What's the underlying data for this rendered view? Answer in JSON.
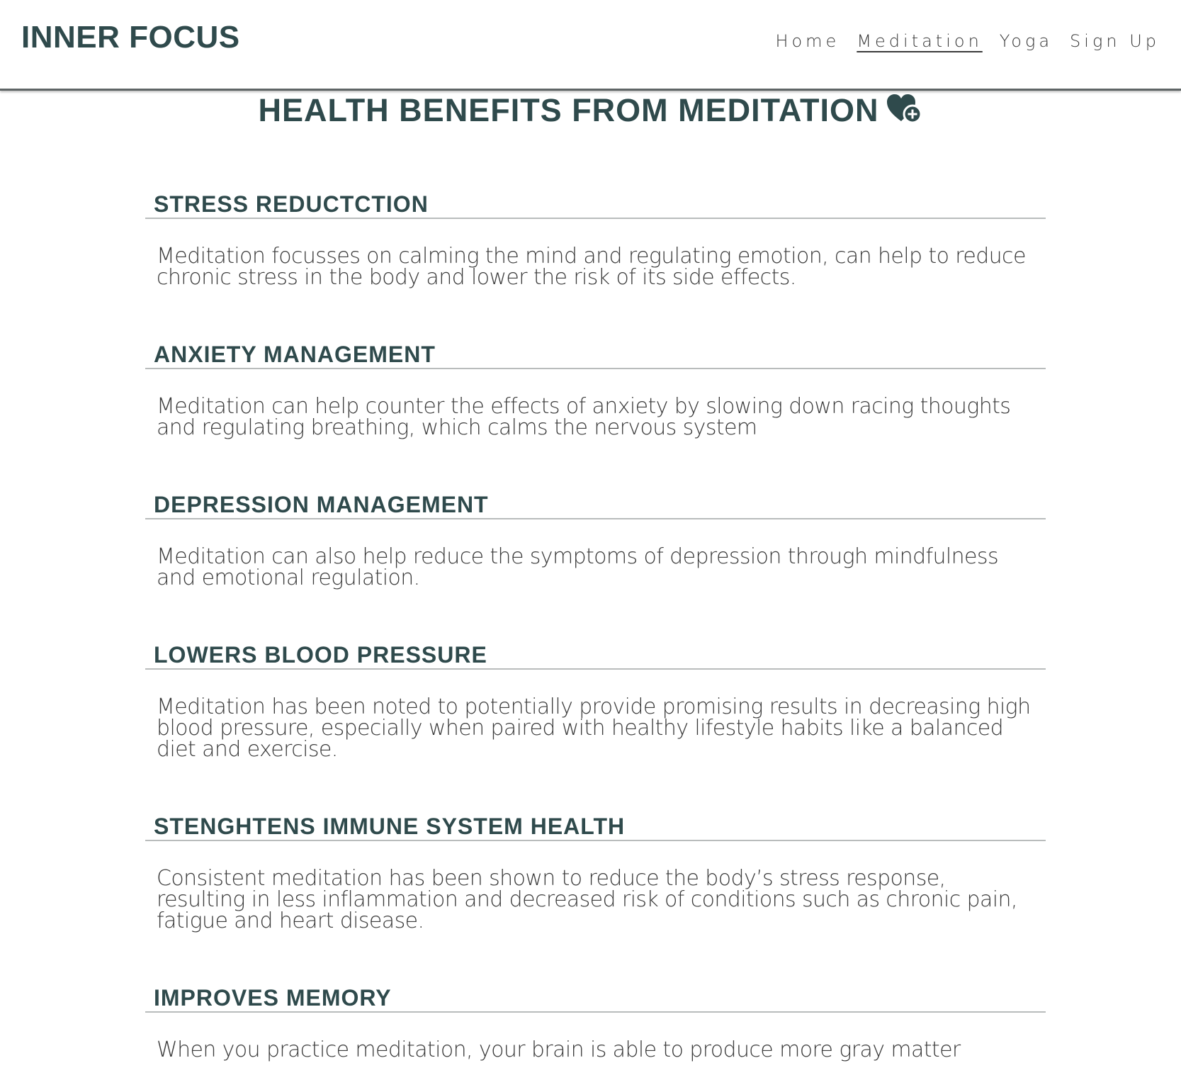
{
  "site": {
    "logo": "INNER FOCUS"
  },
  "nav": {
    "items": [
      {
        "label": "Home",
        "active": false
      },
      {
        "label": "Meditation",
        "active": true
      },
      {
        "label": "Yoga",
        "active": false
      },
      {
        "label": "Sign Up",
        "active": false
      }
    ]
  },
  "page": {
    "title": "HEALTH BENEFITS FROM MEDITATION",
    "title_icon": "heart-plus-icon"
  },
  "sections": [
    {
      "heading": "STRESS REDUCTCTION",
      "body": "Meditation focusses on calming the mind and regulating emotion, can help to reduce chronic stress in the body and lower the risk of its side effects."
    },
    {
      "heading": "ANXIETY MANAGEMENT",
      "body": "Meditation can help counter the effects of anxiety by slowing down racing thoughts and regulating breathing, which calms the nervous system"
    },
    {
      "heading": "DEPRESSION MANAGEMENT",
      "body": "Meditation can also help reduce the symptoms of depression through mindfulness and emotional regulation."
    },
    {
      "heading": "LOWERS BLOOD PRESSURE",
      "body": "Meditation has been noted to potentially provide promising results in decreasing high blood pressure, especially when paired with healthy lifestyle habits like a balanced diet and exercise."
    },
    {
      "heading": "STENGHTENS IMMUNE SYSTEM HEALTH",
      "body": "Consistent meditation has been shown to reduce the body’s stress response, resulting in less inflammation and decreased risk of conditions such as chronic pain, fatigue and heart disease."
    },
    {
      "heading": "IMPROVES MEMORY",
      "body": "When you practice meditation, your brain is able to produce more gray matter"
    }
  ],
  "colors": {
    "primary": "#2f4a4c",
    "body_text": "#3b3b3b",
    "divider": "#b9bcbc",
    "header_border": "#5f6566"
  }
}
